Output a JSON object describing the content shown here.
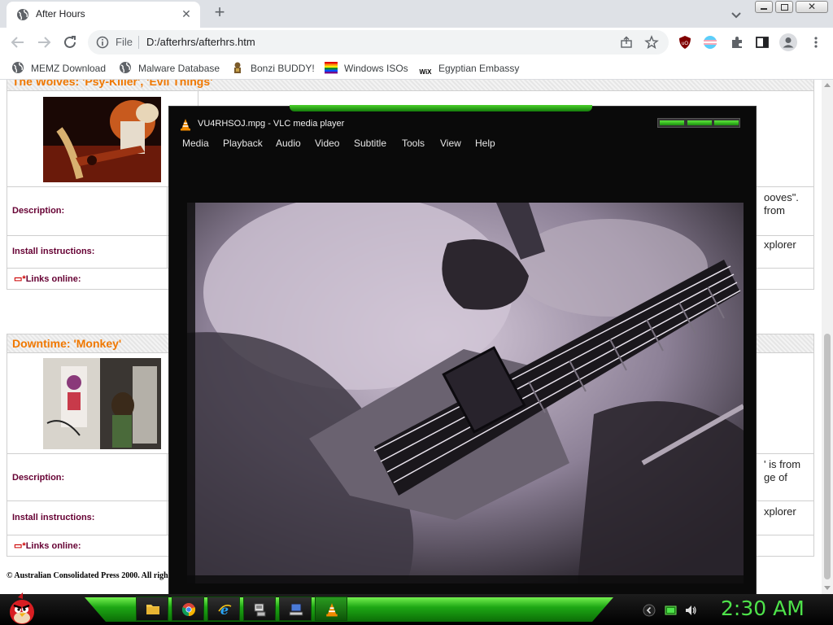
{
  "browser": {
    "tab_title": "After Hours",
    "address_scheme": "File",
    "address_url": "D:/afterhrs/afterhrs.htm",
    "bookmarks": [
      {
        "label": "MEMZ Download",
        "icon": "globe-icon"
      },
      {
        "label": "Malware Database",
        "icon": "globe-icon"
      },
      {
        "label": "Bonzi BUDDY!",
        "icon": "bonzi-icon"
      },
      {
        "label": "Windows ISOs",
        "icon": "windows-flag-icon"
      },
      {
        "label": "Egyptian Embassy",
        "icon": "wix-icon"
      }
    ]
  },
  "page": {
    "blocks": [
      {
        "heading": "The Wolves: 'Psy-Killer', 'Evil Things'",
        "description_label": "Description:",
        "install_label": "Install instructions:",
        "links_label": "Links online:",
        "desc_text_1": "ooves\".",
        "desc_text_2": "from",
        "install_text": "xplorer"
      },
      {
        "heading": "Downtime: 'Monkey'",
        "description_label": "Description:",
        "install_label": "Install instructions:",
        "links_label": "Links online:",
        "desc_text_1": "' is from",
        "desc_text_2": "ge of",
        "install_text": "xplorer"
      }
    ],
    "copyright": "© Australian Consolidated Press 2000. All righ"
  },
  "vlc": {
    "title": "VU4RHSOJ.mpg - VLC media player",
    "menus": [
      "Media",
      "Playback",
      "Audio",
      "Video",
      "Subtitle",
      "Tools",
      "View",
      "Help"
    ]
  },
  "taskbar": {
    "apps": [
      "folder-icon",
      "chrome-icon",
      "ie-icon",
      "network-tool-icon",
      "computer-tool-icon",
      "vlc-icon"
    ],
    "clock": "2:30 AM"
  },
  "colors": {
    "heading": "#f07800",
    "label": "#660033",
    "taskbar_green": "#1ea815",
    "clock": "#4ee34a"
  }
}
